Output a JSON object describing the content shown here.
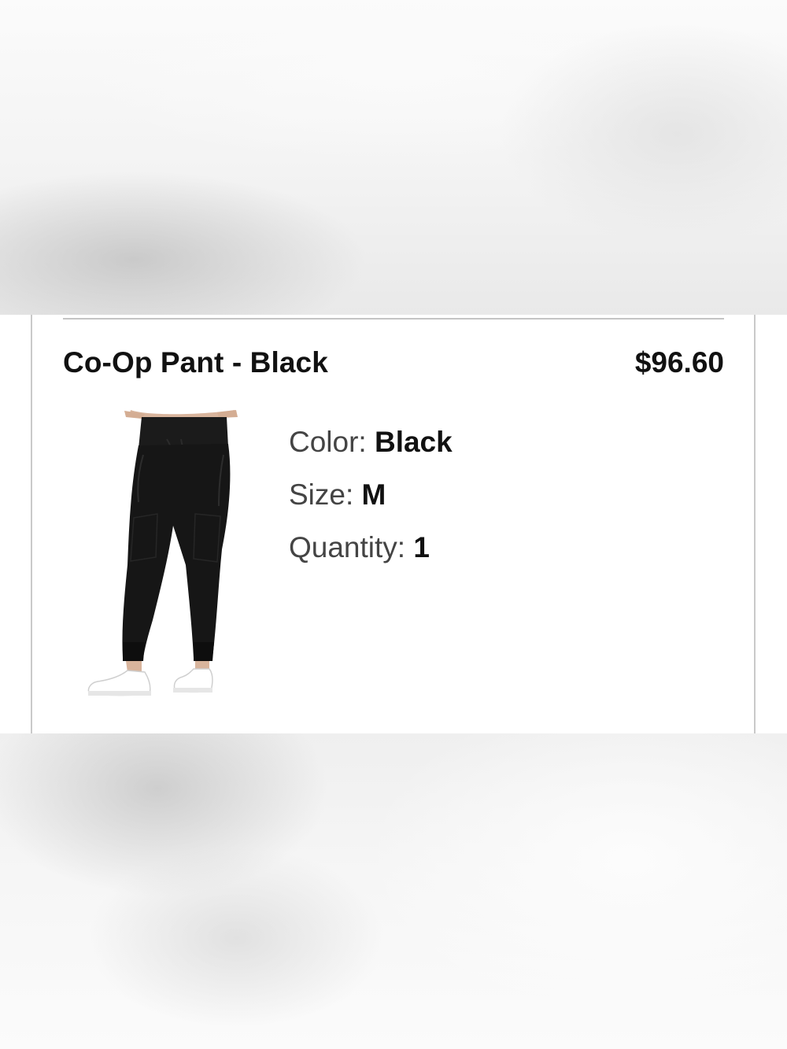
{
  "product": {
    "name": "Co-Op Pant - Black",
    "price": "$96.60",
    "image_subject": "black jogger pants with white sneakers",
    "details": {
      "color_label": "Color:",
      "color_value": "Black",
      "size_label": "Size:",
      "size_value": "M",
      "quantity_label": "Quantity:",
      "quantity_value": "1"
    }
  },
  "colors": {
    "text_primary": "#111111",
    "text_secondary": "#444444",
    "border": "#c9c9c9",
    "product_fabric": "#161616",
    "sneaker": "#ffffff"
  }
}
